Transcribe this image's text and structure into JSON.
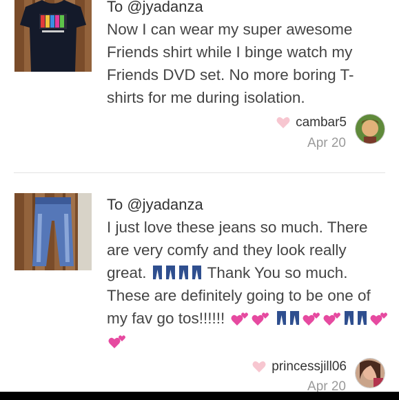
{
  "reviews": [
    {
      "to": "To @jyadanza",
      "message": "Now I can wear my super awesome Friends shirt while I binge watch my Friends DVD set. No more boring T-shirts for me during isolation.",
      "username": "cambar5",
      "date": "Apr 20",
      "thumb_icon": "friends-tshirt-photo",
      "avatar_icon": "user-avatar-photo"
    },
    {
      "to": "To @jyadanza",
      "message_line1": "I just love these jeans so much. There are very comfy and they look really great.",
      "message_line2": "Thank You so much. These are definitely going to be one of my fav go tos!!!!!!",
      "username": "princessjill06",
      "date": "Apr 20",
      "thumb_icon": "jeans-photo",
      "avatar_icon": "user-avatar-photo"
    }
  ],
  "colors": {
    "heart": "#f7c6d0",
    "jeans": "#2f4f8f",
    "hearts_emoji": "#e64aa0"
  }
}
